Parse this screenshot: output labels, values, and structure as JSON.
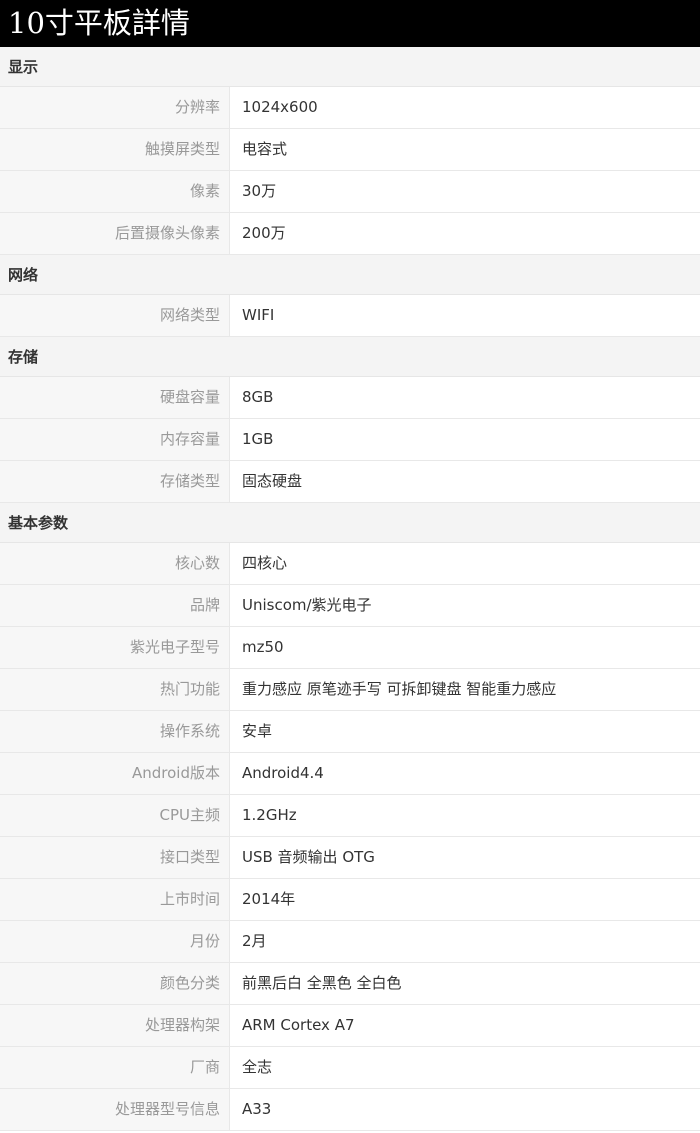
{
  "page": {
    "title": "10寸平板詳情"
  },
  "sections": [
    {
      "header": "显示",
      "rows": [
        {
          "label": "分辨率",
          "value": "1024x600"
        },
        {
          "label": "触摸屏类型",
          "value": "电容式"
        },
        {
          "label": "像素",
          "value": "30万"
        },
        {
          "label": "后置摄像头像素",
          "value": "200万"
        }
      ]
    },
    {
      "header": "网络",
      "rows": [
        {
          "label": "网络类型",
          "value": "WIFI"
        }
      ]
    },
    {
      "header": "存储",
      "rows": [
        {
          "label": "硬盘容量",
          "value": "8GB"
        },
        {
          "label": "内存容量",
          "value": "1GB"
        },
        {
          "label": "存储类型",
          "value": "固态硬盘"
        }
      ]
    },
    {
      "header": "基本参数",
      "rows": [
        {
          "label": "核心数",
          "value": "四核心"
        },
        {
          "label": "品牌",
          "value": "Uniscom/紫光电子"
        },
        {
          "label": "紫光电子型号",
          "value": "mz50"
        },
        {
          "label": "热门功能",
          "value": "重力感应 原笔迹手写 可拆卸键盘 智能重力感应"
        },
        {
          "label": "操作系统",
          "value": "安卓"
        },
        {
          "label": "Android版本",
          "value": "Android4.4"
        },
        {
          "label": "CPU主频",
          "value": "1.2GHz"
        },
        {
          "label": "接口类型",
          "value": "USB 音频输出 OTG"
        },
        {
          "label": "上市时间",
          "value": "2014年"
        },
        {
          "label": "月份",
          "value": "2月"
        },
        {
          "label": "颜色分类",
          "value": "前黑后白 全黑色 全白色"
        },
        {
          "label": "处理器构架",
          "value": "ARM Cortex A7"
        },
        {
          "label": "厂商",
          "value": "全志"
        },
        {
          "label": "处理器型号信息",
          "value": "A33"
        }
      ]
    }
  ]
}
